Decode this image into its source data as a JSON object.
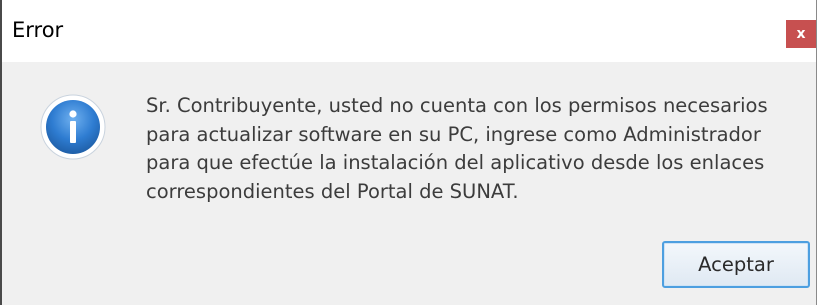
{
  "window": {
    "title": "Error",
    "close_glyph": "x"
  },
  "dialog": {
    "icon": "info-icon",
    "message_lines": [
      "Sr. Contribuyente, usted no cuenta con los permisos necesarios",
      "para actualizar software en su PC, ingrese como Administrador",
      "para que efectúe la instalación del aplicativo desde los enlaces",
      "correspondientes del Portal de SUNAT."
    ],
    "accept_label": "Aceptar"
  },
  "colors": {
    "close_button": "#c75050",
    "accent_border": "#4d9fe0",
    "info_icon": "#2e7cd1"
  }
}
